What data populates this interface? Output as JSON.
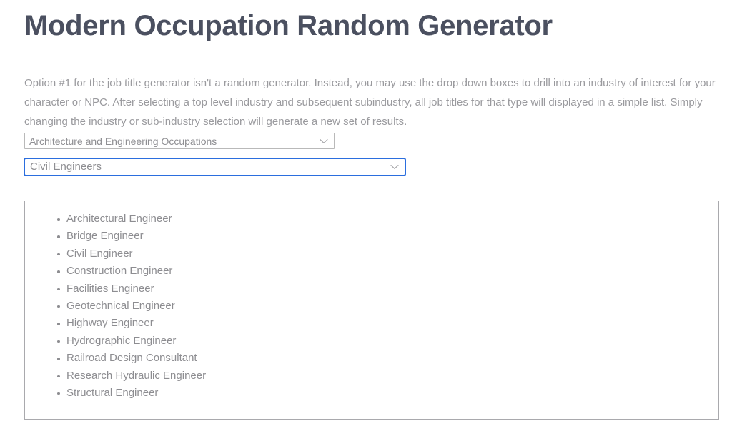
{
  "page": {
    "title": "Modern Occupation Random Generator",
    "intro": "Option #1 for the job title generator isn't a random generator. Instead, you may use the drop down boxes to drill into an industry of interest for your character or NPC. After selecting a top level industry and subsequent subindustry, all job titles for that type will displayed in a simple list. Simply changing the industry or sub-industry selection will generate a new set of results."
  },
  "controls": {
    "industry_select": {
      "name": "industry",
      "selected": "Architecture and Engineering Occupations",
      "icon": "chevron-down-icon",
      "focused": false,
      "border_color": "#b9b9b9"
    },
    "subindustry_select": {
      "name": "sub-industry",
      "selected": "Civil Engineers",
      "icon": "chevron-down-icon",
      "focused": true,
      "border_color": "#2b6ede"
    }
  },
  "results": {
    "items": [
      "Architectural Engineer",
      "Bridge Engineer",
      "Civil Engineer",
      "Construction Engineer",
      "Facilities Engineer",
      "Geotechnical Engineer",
      "Highway Engineer",
      "Hydrographic Engineer",
      "Railroad Design Consultant",
      "Research Hydraulic Engineer",
      "Structural Engineer"
    ],
    "bullet_icon": "dot-bullet-icon",
    "border_color": "#a9a9ad"
  },
  "colors": {
    "title": "#4b5060",
    "body_text": "#9a9a9e",
    "select_text": "#8e8e92",
    "list_text": "#8d8d91",
    "focus_blue": "#2b6ede",
    "background": "#ffffff"
  }
}
